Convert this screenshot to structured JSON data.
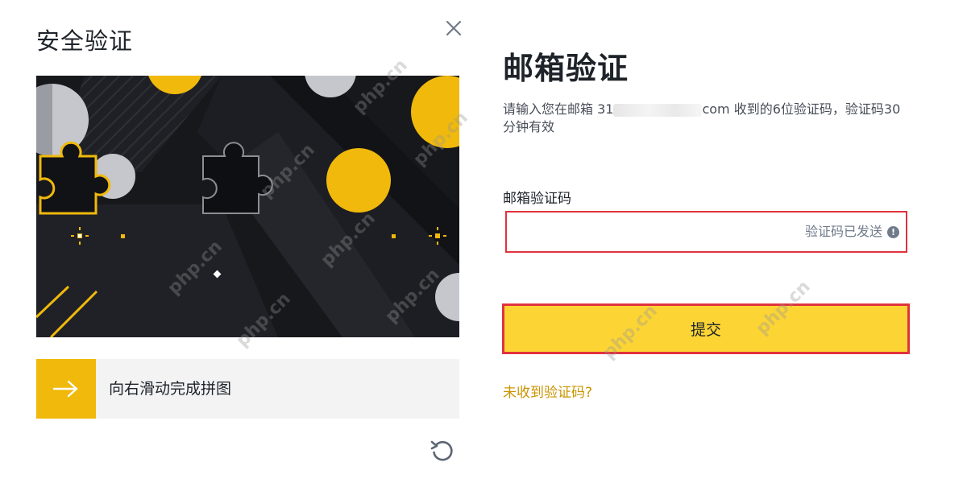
{
  "captcha": {
    "title": "安全验证",
    "close_icon": "close-icon",
    "slider_text": "向右滑动完成拼图",
    "slider_icon": "arrow-right-icon",
    "refresh_icon": "refresh-icon",
    "accent_color": "#f0b90b"
  },
  "verify": {
    "title": "邮箱验证",
    "desc_before": "请输入您在邮箱 31",
    "desc_after": "com 收到的6位验证码，验证码30分钟有效",
    "field_label": "邮箱验证码",
    "input_value": "",
    "sent_hint": "验证码已发送",
    "info_icon": "info-icon",
    "submit_label": "提交",
    "resend_link": "未收到验证码?",
    "button_color": "#fcd535",
    "highlight_color": "#e0333d",
    "link_color": "#c99400"
  },
  "watermark": "php.cn"
}
